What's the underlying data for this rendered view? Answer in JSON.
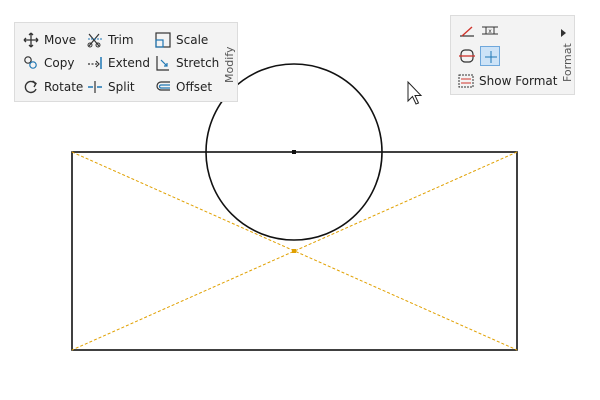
{
  "modify": {
    "title": "Modify",
    "tools": [
      {
        "label": "Move",
        "icon": "move-icon"
      },
      {
        "label": "Copy",
        "icon": "copy-icon"
      },
      {
        "label": "Rotate",
        "icon": "rotate-icon"
      },
      {
        "label": "Trim",
        "icon": "trim-icon"
      },
      {
        "label": "Extend",
        "icon": "extend-icon"
      },
      {
        "label": "Split",
        "icon": "split-icon"
      },
      {
        "label": "Scale",
        "icon": "scale-icon"
      },
      {
        "label": "Stretch",
        "icon": "stretch-icon"
      },
      {
        "label": "Offset",
        "icon": "offset-icon"
      }
    ]
  },
  "format": {
    "title": "Format",
    "show_format_label": "Show Format"
  },
  "colors": {
    "accent": "#1f77b4",
    "guide": "#e0a000",
    "geometry": "#111111"
  }
}
